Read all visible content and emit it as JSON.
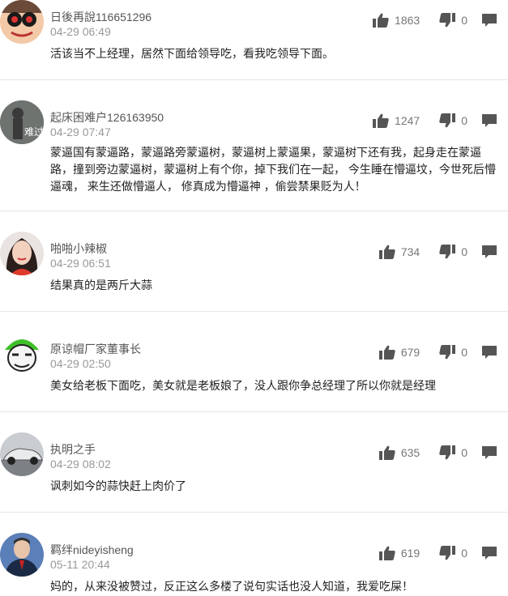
{
  "comments": [
    {
      "user": "日後再說116651296",
      "time": "04-29 06:49",
      "text": "活该当不上经理，居然下面给领导吃，看我吃领导下面。",
      "likes": "1863",
      "dislikes": "0"
    },
    {
      "user": "起床困难户126163950",
      "time": "04-29 07:47",
      "text": "蒙逼国有蒙逼路，蒙逼路旁蒙逼树，蒙逼树上蒙逼果，蒙逼树下还有我，起身走在蒙逼路，撞到旁边蒙逼树，蒙逼树上有个你，掉下我们在一起， 今生睡在懵逼坟，今世死后懵逼魂， 来生还做懵逼人， 修真成为懵逼神 ，偷尝禁果贬为人！",
      "avatar_text": "难过",
      "likes": "1247",
      "dislikes": "0"
    },
    {
      "user": "啪啪小辣椒",
      "time": "04-29 06:51",
      "text": "结果真的是两斤大蒜",
      "likes": "734",
      "dislikes": "0"
    },
    {
      "user": "原谅帽厂家董事长",
      "time": "04-29 02:50",
      "text": "美女给老板下面吃，美女就是老板娘了，没人跟你争总经理了所以你就是经理",
      "likes": "679",
      "dislikes": "0"
    },
    {
      "user": "执明之手",
      "time": "04-29 08:02",
      "text": "讽刺如今的蒜快赶上肉价了",
      "likes": "635",
      "dislikes": "0"
    },
    {
      "user": "羁绊nideyisheng",
      "time": "05-11 20:44",
      "text": "妈的，从来没被赞过，反正这么多楼了说句实话也没人知道，我爱吃屎！",
      "likes": "619",
      "dislikes": "0"
    }
  ],
  "icons": {
    "like": "thumbs-up-icon",
    "dislike": "thumbs-down-icon",
    "reply": "comment-icon"
  },
  "colors": {
    "icon": "#555555",
    "name": "#555555",
    "time": "#999999",
    "divider": "#e6e6e6"
  }
}
